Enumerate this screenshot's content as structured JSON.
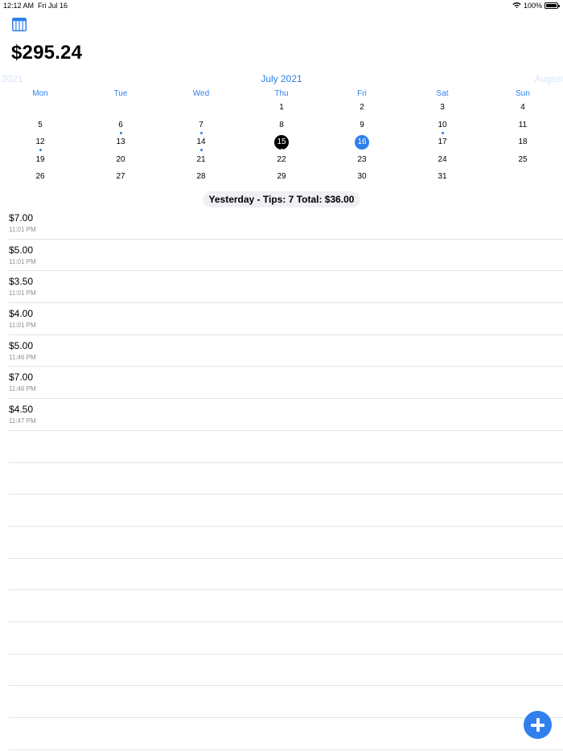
{
  "status_bar": {
    "time": "12:12 AM",
    "date": "Fri Jul 16",
    "battery": "100%"
  },
  "toolbar": {
    "calendar_icon": "calendar-icon"
  },
  "balance": "$295.24",
  "calendar": {
    "prev_month": "2021",
    "current_month": "July 2021",
    "next_month": "August",
    "weekdays": [
      "Mon",
      "Tue",
      "Wed",
      "Thu",
      "Fri",
      "Sat",
      "Sun"
    ],
    "weeks": [
      [
        "",
        "",
        "",
        "1",
        "2",
        "3",
        "4"
      ],
      [
        "5",
        "6",
        "7",
        "8",
        "9",
        "10",
        "11"
      ],
      [
        "12",
        "13",
        "14",
        "15",
        "16",
        "17",
        "18"
      ],
      [
        "19",
        "20",
        "21",
        "22",
        "23",
        "24",
        "25"
      ],
      [
        "26",
        "27",
        "28",
        "29",
        "30",
        "31",
        ""
      ]
    ],
    "selected_day": "15",
    "today": "16",
    "days_with_tips": [
      "6",
      "7",
      "10",
      "12",
      "14",
      "15"
    ],
    "dot_colors": {
      "6": "#2f80ed",
      "7": "#2f80ed",
      "10": "#2f80ed",
      "12": "#2f80ed",
      "14": "#2f80ed",
      "15": "#ffffff"
    }
  },
  "summary": "Yesterday - Tips: 7  Total: $36.00",
  "tips": [
    {
      "amount": "$7.00",
      "time": "11:01 PM"
    },
    {
      "amount": "$5.00",
      "time": "11:01 PM"
    },
    {
      "amount": "$3.50",
      "time": "11:01 PM"
    },
    {
      "amount": "$4.00",
      "time": "11:01 PM"
    },
    {
      "amount": "$5.00",
      "time": "11:46 PM"
    },
    {
      "amount": "$7.00",
      "time": "11:46 PM"
    },
    {
      "amount": "$4.50",
      "time": "11:47 PM"
    }
  ],
  "empty_rows": 10,
  "add_button": {
    "icon": "plus-icon"
  },
  "colors": {
    "accent": "#2f80ed",
    "selected_day_bg": "#000000",
    "faded_month": "#d7e6f8",
    "secondary_text": "#8e8e93",
    "separator": "#e3e3e8",
    "summary_bg": "#efeff4"
  }
}
